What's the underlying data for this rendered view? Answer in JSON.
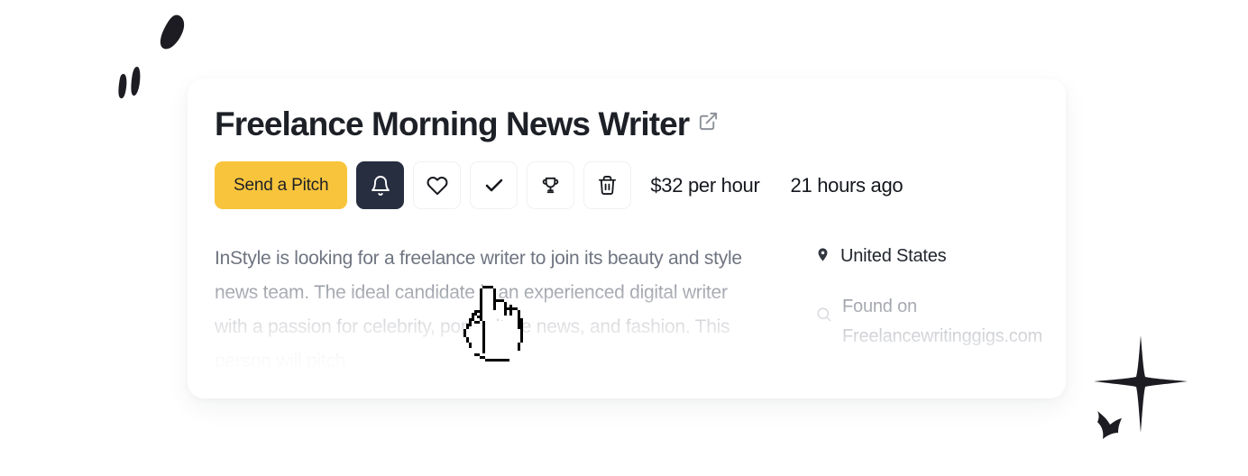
{
  "card": {
    "title": "Freelance Morning News Writer",
    "external_link_icon": "external-link-icon",
    "actions": {
      "pitch_label": "Send a Pitch",
      "notify_icon": "bell-icon",
      "favorite_icon": "heart-icon",
      "applied_icon": "check-icon",
      "award_icon": "trophy-icon",
      "delete_icon": "trash-icon"
    },
    "meta": {
      "rate": "$32 per hour",
      "posted": "21 hours ago"
    },
    "description": "InStyle is looking for a freelance writer to join its beauty and style news team. The ideal candidate is an experienced digital writer with a passion for celebrity, pop culture news, and fashion. This person will pitch",
    "info": {
      "location_icon": "map-pin-icon",
      "location": "United States",
      "source_icon": "search-icon",
      "source_prefix": "Found on",
      "source_site": "Freelancewritinggigs.com"
    }
  },
  "decorations": {
    "top_left": "doodle-quote-marks",
    "bottom_right": "doodle-sparkle-star",
    "cursor": "pointing-hand-cursor"
  },
  "colors": {
    "accent": "#F8C43C",
    "dark": "#262E40",
    "page_bg": "#FFFFFF",
    "card_bg": "#FFFFFF",
    "title_text": "#1D2026",
    "body_text": "#6F7480"
  }
}
